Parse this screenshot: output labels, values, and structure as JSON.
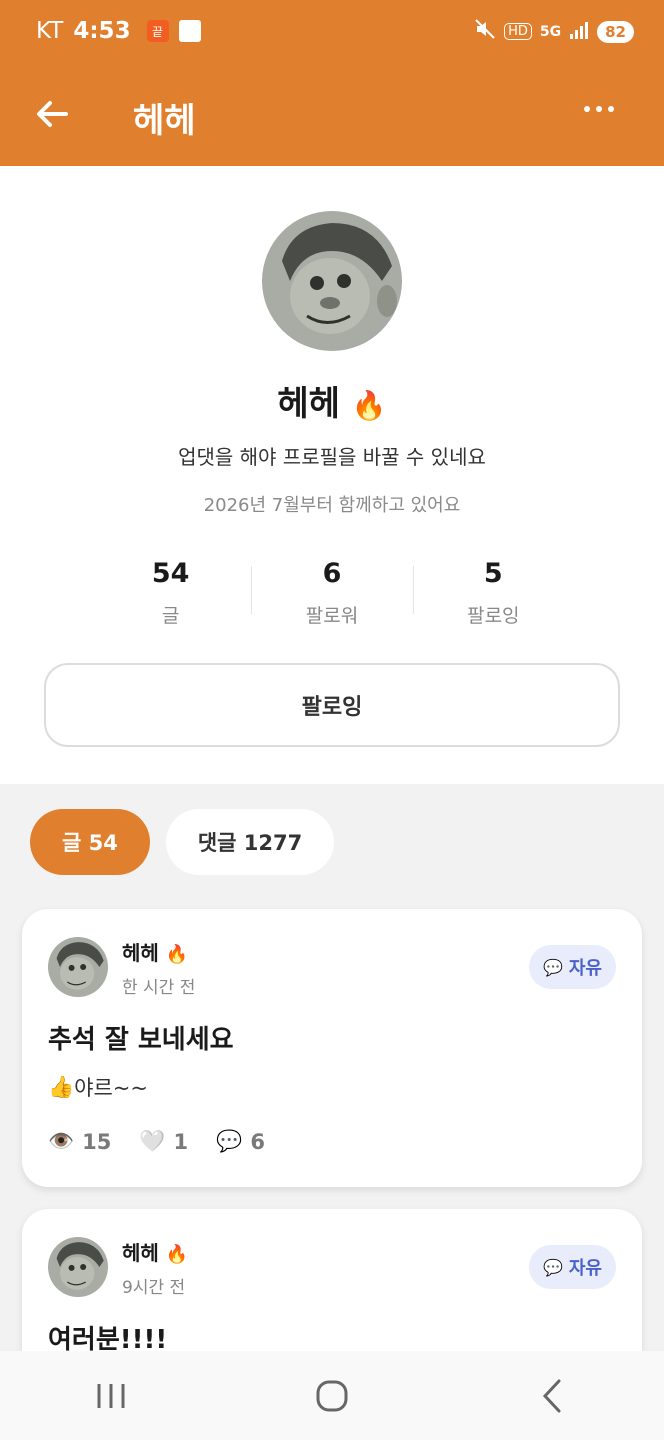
{
  "status_bar": {
    "carrier": "KT",
    "time": "4:53",
    "app_icon_1": "끝",
    "battery": "82",
    "network": "5G",
    "hd_label": "HD"
  },
  "app_bar": {
    "title": "헤헤"
  },
  "profile": {
    "name": "헤헤",
    "bio": "업댓을 해야 프로필을 바꿀 수 있네요",
    "joined": "2026년 7월부터 함께하고 있어요",
    "stats": [
      {
        "value": "54",
        "label": "글"
      },
      {
        "value": "6",
        "label": "팔로워"
      },
      {
        "value": "5",
        "label": "팔로잉"
      }
    ],
    "follow_button": "팔로잉"
  },
  "tabs": [
    {
      "label": "글 54",
      "active": true
    },
    {
      "label": "댓글 1277",
      "active": false
    }
  ],
  "posts": [
    {
      "author": "헤헤",
      "time": "한 시간 전",
      "category": "자유",
      "title": "추석 잘 보네세요",
      "body": "야르~~",
      "body_icon": "thumbs-up-icon",
      "views": "15",
      "likes": "1",
      "comments": "6"
    },
    {
      "author": "헤헤",
      "time": "9시간 전",
      "category": "자유",
      "title": "여러분!!!!"
    }
  ],
  "colors": {
    "accent": "#e0802f",
    "badge_bg": "#e8ecfb",
    "badge_text": "#4a62c8"
  }
}
